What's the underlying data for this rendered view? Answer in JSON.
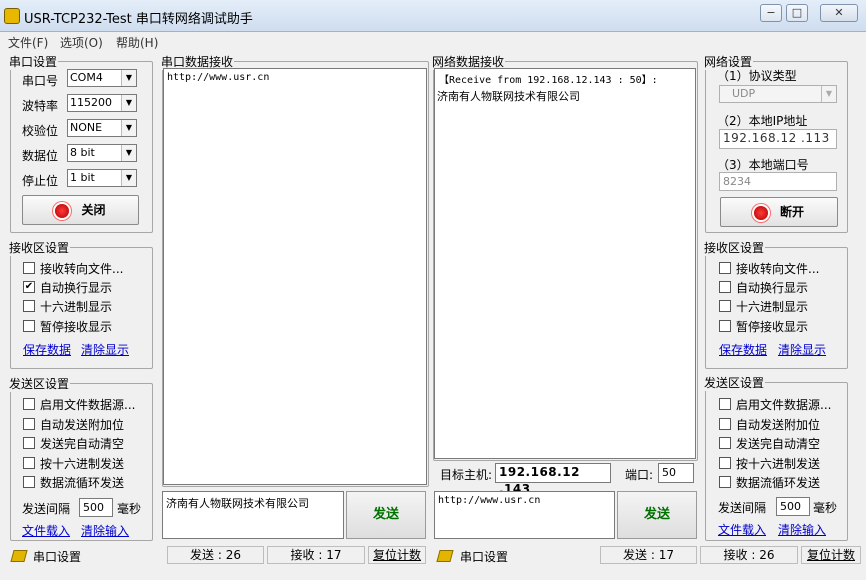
{
  "window": {
    "title": "USR-TCP232-Test 串口转网络调试助手",
    "minimize": "−",
    "maximize": "□",
    "close": "✕"
  },
  "menu": [
    "文件(F)",
    "选项(O)",
    "帮助(H)"
  ],
  "serial": {
    "legend": "串口设置",
    "fields": [
      {
        "label": "串口号",
        "value": "COM4"
      },
      {
        "label": "波特率",
        "value": "115200"
      },
      {
        "label": "校验位",
        "value": "NONE"
      },
      {
        "label": "数据位",
        "value": "8 bit"
      },
      {
        "label": "停止位",
        "value": "1 bit"
      }
    ],
    "button": "关闭"
  },
  "recv_left": {
    "legend": "接收区设置",
    "options": [
      {
        "label": "接收转向文件...",
        "checked": false
      },
      {
        "label": "自动换行显示",
        "checked": true
      },
      {
        "label": "十六进制显示",
        "checked": false
      },
      {
        "label": "暂停接收显示",
        "checked": false
      }
    ],
    "save": "保存数据",
    "clear": "清除显示"
  },
  "send_left": {
    "legend": "发送区设置",
    "options": [
      {
        "label": "启用文件数据源...",
        "checked": false
      },
      {
        "label": "自动发送附加位",
        "checked": false
      },
      {
        "label": "发送完自动清空",
        "checked": false
      },
      {
        "label": "按十六进制发送",
        "checked": false
      },
      {
        "label": "数据流循环发送",
        "checked": false
      }
    ],
    "interval_label": "发送间隔",
    "interval": "500",
    "unit": "毫秒",
    "load": "文件载入",
    "clear": "清除输入"
  },
  "serial_recv": {
    "legend": "串口数据接收",
    "content": "http://www.usr.cn"
  },
  "net_recv": {
    "legend": "网络数据接收",
    "line1": "【Receive from 192.168.12.143 : 50】:",
    "line2": "济南有人物联网技术有限公司"
  },
  "target": {
    "host_label": "目标主机:",
    "host": "192.168.12 .143",
    "port_label": "端口:",
    "port": "50"
  },
  "serial_send": {
    "content": "济南有人物联网技术有限公司",
    "button": "发送"
  },
  "net_send": {
    "content": "http://www.usr.cn",
    "button": "发送"
  },
  "net": {
    "legend": "网络设置",
    "protocol_label": "（1）协议类型",
    "protocol": "UDP",
    "ip_label": "（2）本地IP地址",
    "ip": "192.168.12 .113",
    "port_label": "（3）本地端口号",
    "port": "8234",
    "button": "断开"
  },
  "recv_right": {
    "legend": "接收区设置",
    "options": [
      {
        "label": "接收转向文件...",
        "checked": false
      },
      {
        "label": "自动换行显示",
        "checked": false
      },
      {
        "label": "十六进制显示",
        "checked": false
      },
      {
        "label": "暂停接收显示",
        "checked": false
      }
    ],
    "save": "保存数据",
    "clear": "清除显示"
  },
  "send_right": {
    "legend": "发送区设置",
    "options": [
      {
        "label": "启用文件数据源...",
        "checked": false
      },
      {
        "label": "自动发送附加位",
        "checked": false
      },
      {
        "label": "发送完自动清空",
        "checked": false
      },
      {
        "label": "按十六进制发送",
        "checked": false
      },
      {
        "label": "数据流循环发送",
        "checked": false
      }
    ],
    "interval_label": "发送间隔",
    "interval": "500",
    "unit": "毫秒",
    "load": "文件载入",
    "clear": "清除输入"
  },
  "status_left": {
    "label": "串口设置",
    "send": "发送 : 26",
    "recv": "接收 : 17",
    "reset": "复位计数"
  },
  "status_right": {
    "label": "串口设置",
    "send": "发送 : 17",
    "recv": "接收 : 26",
    "reset": "复位计数"
  }
}
